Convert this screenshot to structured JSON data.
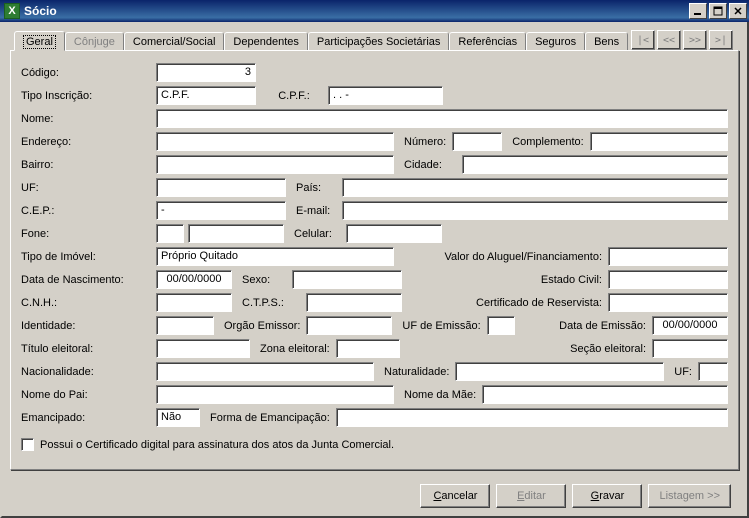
{
  "window": {
    "title": "Sócio"
  },
  "nav": {
    "first": "|<",
    "prev": "<<",
    "next": ">>",
    "last": ">|"
  },
  "tabs": {
    "geral": "Geral",
    "conjuge": "Cônjuge",
    "comercial": "Comercial/Social",
    "dependentes": "Dependentes",
    "participacoes": "Participações Societárias",
    "referencias": "Referências",
    "seguros": "Seguros",
    "bens": "Bens"
  },
  "labels": {
    "codigo": "Código:",
    "tipo_inscricao": "Tipo Inscrição:",
    "cpf": "C.P.F.:",
    "nome": "Nome:",
    "endereco": "Endereço:",
    "numero": "Número:",
    "complemento": "Complemento:",
    "bairro": "Bairro:",
    "cidade": "Cidade:",
    "uf": "UF:",
    "pais": "País:",
    "cep": "C.E.P.:",
    "email": "E-mail:",
    "fone": "Fone:",
    "celular": "Celular:",
    "tipo_imovel": "Tipo de Imóvel:",
    "valor_aluguel": "Valor do Aluguel/Financiamento:",
    "data_nasc": "Data de Nascimento:",
    "sexo": "Sexo:",
    "estado_civil": "Estado Civil:",
    "cnh": "C.N.H.:",
    "ctps": "C.T.P.S.:",
    "cert_reservista": "Certificado de Reservista:",
    "identidade": "Identidade:",
    "orgao_emissor": "Orgão Emissor:",
    "uf_emissao": "UF de Emissão:",
    "data_emissao": "Data de Emissão:",
    "titulo_eleitoral": "Título eleitoral:",
    "zona_eleitoral": "Zona eleitoral:",
    "secao_eleitoral": "Seção eleitoral:",
    "nacionalidade": "Nacionalidade:",
    "naturalidade": "Naturalidade:",
    "uf2": "UF:",
    "nome_pai": "Nome do Pai:",
    "nome_mae": "Nome da Mãe:",
    "emancipado": "Emancipado:",
    "forma_emanc": "Forma de Emancipação:",
    "certificado_digital": "Possui o Certificado digital para assinatura dos atos da Junta Comercial."
  },
  "values": {
    "codigo": "3",
    "tipo_inscricao": "C.P.F.",
    "cpf": ".   .   -",
    "nome": "",
    "endereco": "",
    "numero": "",
    "complemento": "",
    "bairro": "",
    "cidade": "",
    "uf": "",
    "pais": "",
    "cep": "     -",
    "email": "",
    "fone_ddd": "",
    "fone": "",
    "celular": "",
    "tipo_imovel": "Próprio Quitado",
    "valor_aluguel": "",
    "data_nasc": "00/00/0000",
    "sexo": "",
    "estado_civil": "",
    "cnh": "",
    "ctps": "",
    "cert_reservista": "",
    "identidade": "",
    "orgao_emissor": "",
    "uf_emissao": "",
    "data_emissao": "00/00/0000",
    "titulo_eleitoral": "",
    "zona_eleitoral": "",
    "secao_eleitoral": "",
    "nacionalidade": "",
    "naturalidade": "",
    "naturalidade_uf": "",
    "nome_pai": "",
    "nome_mae": "",
    "emancipado": "Não",
    "forma_emanc": ""
  },
  "buttons": {
    "cancelar": "Cancelar",
    "editar": "Editar",
    "gravar": "Gravar",
    "listagem": "Listagem >>"
  }
}
